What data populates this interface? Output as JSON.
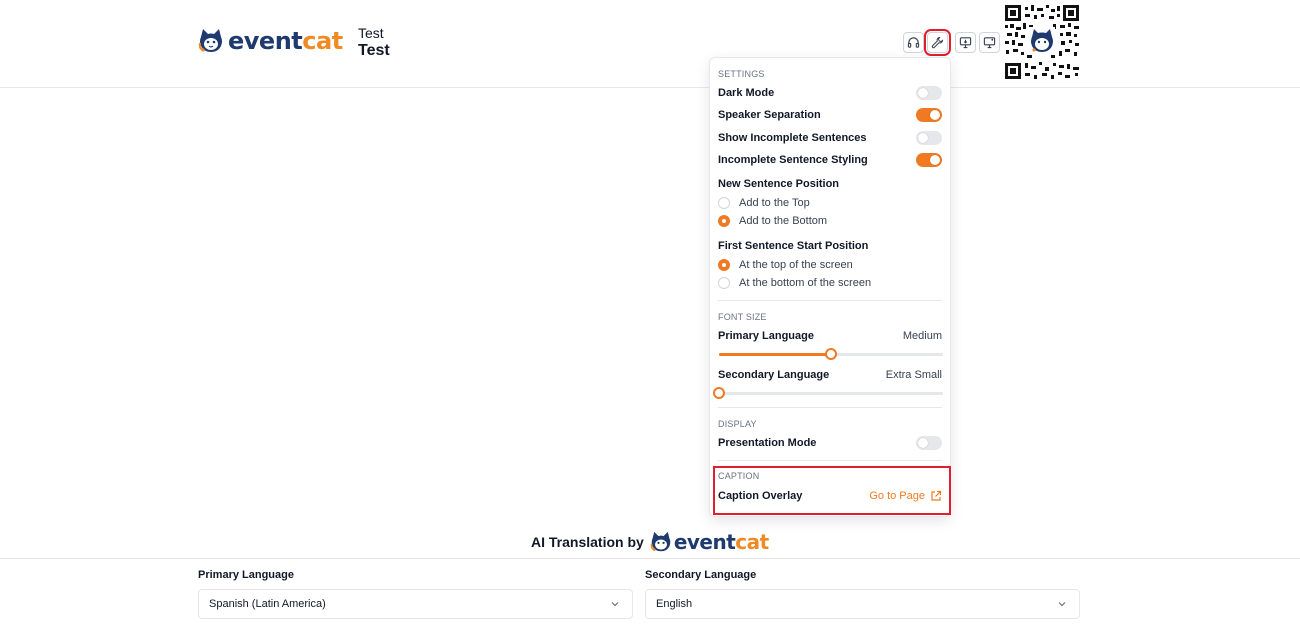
{
  "header": {
    "brand_part1": "event",
    "brand_part2": "cat",
    "event_title_line1": "Test",
    "event_title_line2": "Test",
    "buttons": [
      {
        "name": "headphones-icon"
      },
      {
        "name": "wrench-icon",
        "active": true
      },
      {
        "name": "presentation-icon"
      },
      {
        "name": "monitor-icon"
      }
    ],
    "qr_code": "qr-code-icon"
  },
  "settings": {
    "section_settings": "SETTINGS",
    "dark_mode": {
      "label": "Dark Mode",
      "on": false
    },
    "speaker_separation": {
      "label": "Speaker Separation",
      "on": true
    },
    "show_incomplete": {
      "label": "Show Incomplete Sentences",
      "on": false
    },
    "incomplete_styling": {
      "label": "Incomplete Sentence Styling",
      "on": true
    },
    "new_sentence_position": {
      "label": "New Sentence Position",
      "options": [
        "Add to the Top",
        "Add to the Bottom"
      ],
      "selected": 1
    },
    "first_sentence_start": {
      "label": "First Sentence Start Position",
      "options": [
        "At the top of the screen",
        "At the bottom of the screen"
      ],
      "selected": 0
    },
    "section_font_size": "FONT SIZE",
    "primary_language": {
      "label": "Primary Language",
      "value": "Medium",
      "level": 0.5
    },
    "secondary_language": {
      "label": "Secondary Language",
      "value": "Extra Small",
      "level": 0.0
    },
    "section_display": "DISPLAY",
    "presentation_mode": {
      "label": "Presentation Mode",
      "on": false
    },
    "section_caption": "CAPTION",
    "caption_overlay": {
      "label": "Caption Overlay",
      "link": "Go to Page"
    }
  },
  "footer": {
    "ai_translation_by": "AI Translation by",
    "primary_language_label": "Primary Language",
    "primary_language_value": "Spanish (Latin America)",
    "secondary_language_label": "Secondary Language",
    "secondary_language_value": "English"
  },
  "colors": {
    "accent": "#f07a24",
    "brand_navy": "#1e3a6e",
    "highlight": "#e11d2e"
  }
}
